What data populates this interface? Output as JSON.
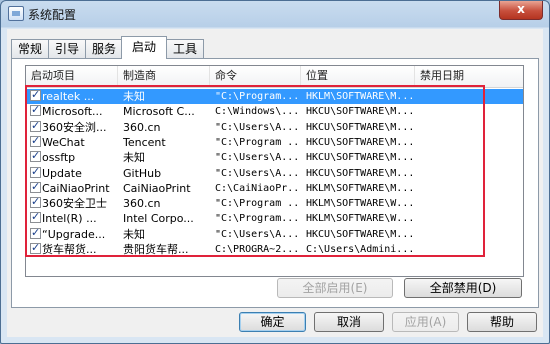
{
  "window": {
    "title": "系统配置",
    "close_label": "x"
  },
  "tabs": [
    {
      "label": "常规"
    },
    {
      "label": "引导"
    },
    {
      "label": "服务"
    },
    {
      "label": "启动",
      "active": true
    },
    {
      "label": "工具"
    }
  ],
  "columns": [
    "启动项目",
    "制造商",
    "命令",
    "位置",
    "禁用日期"
  ],
  "rows": [
    {
      "checked": true,
      "selected": true,
      "item": "realtek ...",
      "maker": "未知",
      "command": "\"C:\\Program...",
      "location": "HKLM\\SOFTWARE\\M...",
      "disabled": ""
    },
    {
      "checked": true,
      "item": "Microsoft...",
      "maker": "Microsoft C...",
      "command": "C:\\Windows\\...",
      "location": "HKCU\\SOFTWARE\\M...",
      "disabled": ""
    },
    {
      "checked": true,
      "item": "360安全浏...",
      "maker": "360.cn",
      "command": "\"C:\\Users\\A...",
      "location": "HKCU\\SOFTWARE\\M...",
      "disabled": ""
    },
    {
      "checked": true,
      "item": "WeChat",
      "maker": "Tencent",
      "command": "\"C:\\Program ...",
      "location": "HKCU\\SOFTWARE\\M...",
      "disabled": ""
    },
    {
      "checked": true,
      "item": "ossftp",
      "maker": "未知",
      "command": "\"C:\\Users\\A...",
      "location": "HKCU\\SOFTWARE\\M...",
      "disabled": ""
    },
    {
      "checked": true,
      "item": "Update",
      "maker": "GitHub",
      "command": "\"C:\\Users\\A...",
      "location": "HKCU\\SOFTWARE\\M...",
      "disabled": ""
    },
    {
      "checked": true,
      "item": "CaiNiaoPrint",
      "maker": "CaiNiaoPrint",
      "command": "C:\\CaiNiaoPr...",
      "location": "HKLM\\SOFTWARE\\M...",
      "disabled": ""
    },
    {
      "checked": true,
      "item": "360安全卫士",
      "maker": "360.cn",
      "command": "\"C:\\Program ...",
      "location": "HKLM\\SOFTWARE\\W...",
      "disabled": ""
    },
    {
      "checked": true,
      "item": "Intel(R) ...",
      "maker": "Intel Corpo...",
      "command": "\"C:\\Program...",
      "location": "HKLM\\SOFTWARE\\W...",
      "disabled": ""
    },
    {
      "checked": true,
      "item": "“Upgrade...",
      "maker": "未知",
      "command": "\"C:\\Users\\A...",
      "location": "HKCU\\SOFTWARE\\M...",
      "disabled": ""
    },
    {
      "checked": true,
      "item": "货车帮货...",
      "maker": "贵阳货车帮...",
      "command": "C:\\PROGRA~2...",
      "location": "C:\\Users\\Admini...",
      "disabled": ""
    }
  ],
  "buttons": {
    "enable_all": "全部启用(E)",
    "disable_all": "全部禁用(D)",
    "ok": "确定",
    "cancel": "取消",
    "apply": "应用(A)",
    "help": "帮助"
  },
  "colors": {
    "selection": "#3399ff",
    "annotation_box": "#e0223a"
  }
}
